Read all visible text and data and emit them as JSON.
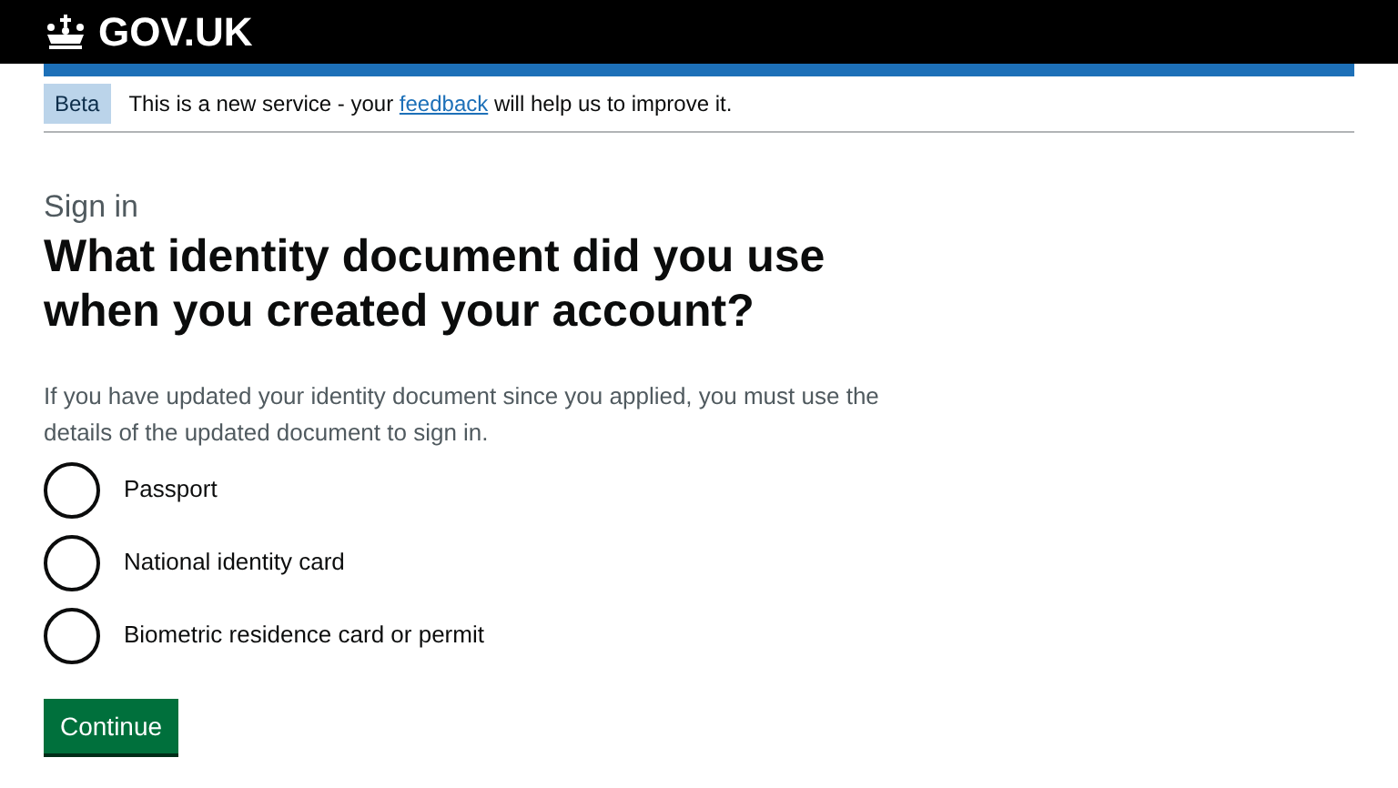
{
  "header": {
    "logo_text": "GOV.UK"
  },
  "phase_banner": {
    "tag": "Beta",
    "text_before": "This is a new service - your",
    "link": "feedback",
    "text_after": "will help us to improve it."
  },
  "caption": "Sign in",
  "heading": "What identity document did you use when you created your account?",
  "hint": "If you have updated your identity document since you applied, you must use the details of the updated document to sign in.",
  "options": [
    {
      "label": "Passport",
      "selected": false
    },
    {
      "label": "National identity card",
      "selected": false
    },
    {
      "label": "Biometric residence card or permit",
      "selected": false
    }
  ],
  "button": "Continue"
}
